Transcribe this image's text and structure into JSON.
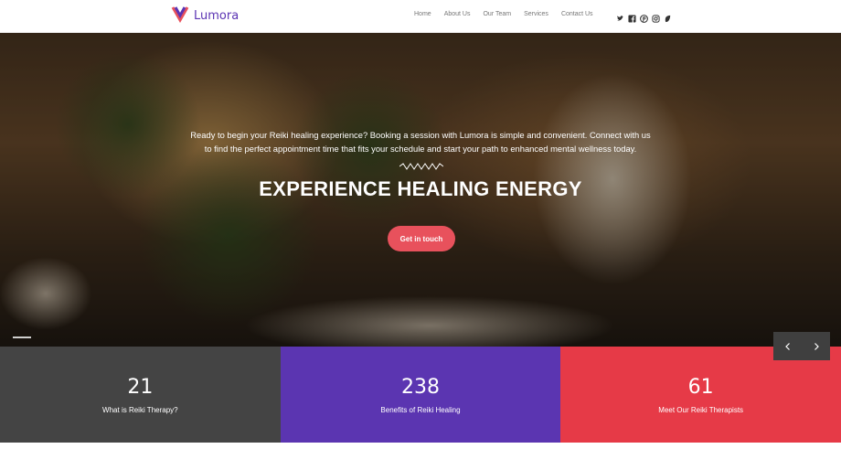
{
  "brand": {
    "name": "Lumora",
    "logo_icon": "lumora-logo-icon"
  },
  "nav": {
    "links": [
      "Home",
      "About Us",
      "Our Team",
      "Services",
      "Contact Us"
    ],
    "social_icons": [
      "twitter-icon",
      "facebook-icon",
      "pinterest-icon",
      "instagram-icon",
      "gem-icon"
    ]
  },
  "hero": {
    "intro_line1": "Ready to begin your Reiki healing experience? Booking a session with Lumora is simple and convenient. Connect with us",
    "intro_line2": "to find the perfect appointment time that fits your schedule and start your path to enhanced mental wellness today.",
    "title": "EXPERIENCE HEALING ENERGY",
    "cta_label": "Get in touch"
  },
  "slider": {
    "prev_icon": "chevron-left-icon",
    "next_icon": "chevron-right-icon"
  },
  "stats": [
    {
      "number": "21",
      "label": "What is Reiki Therapy?",
      "color": "#444444"
    },
    {
      "number": "238",
      "label": "Benefits of Reiki Healing",
      "color": "#5b35b1"
    },
    {
      "number": "61",
      "label": "Meet Our Reiki Therapists",
      "color": "#e63a47"
    }
  ],
  "colors": {
    "accent_purple": "#5b34b3",
    "cta_red": "#e8515c"
  }
}
